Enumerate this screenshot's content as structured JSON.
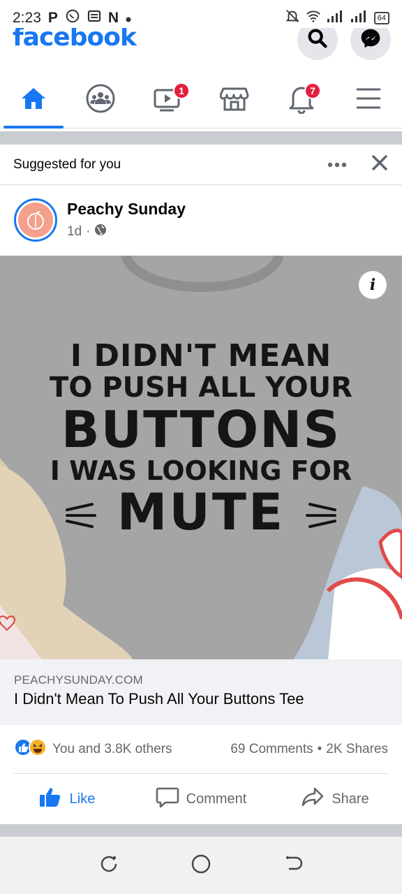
{
  "status_bar": {
    "time": "2:23",
    "left_glyphs": [
      "P",
      "N"
    ],
    "battery": "64"
  },
  "header": {
    "logo": "facebook"
  },
  "nav": {
    "items": [
      {
        "name": "home",
        "active": true
      },
      {
        "name": "groups"
      },
      {
        "name": "watch",
        "badge": "1"
      },
      {
        "name": "marketplace"
      },
      {
        "name": "notifications",
        "badge": "7"
      },
      {
        "name": "menu"
      }
    ]
  },
  "suggested": {
    "label": "Suggested for you"
  },
  "post": {
    "page_name": "Peachy Sunday",
    "time": "1d",
    "separator": "·",
    "image_text": {
      "line1": "I DIDN'T MEAN",
      "line2": "TO PUSH ALL YOUR",
      "line3": "BUTTONS",
      "line4": "I WAS LOOKING FOR",
      "line5": "MUTE"
    },
    "link": {
      "domain": "PEACHYSUNDAY.COM",
      "title": "I Didn't Mean To Push All Your Buttons Tee"
    },
    "reactions": {
      "summary": "You and 3.8K others",
      "comments": "69 Comments",
      "dot": "•",
      "shares": "2K Shares"
    },
    "actions": {
      "like": "Like",
      "comment": "Comment",
      "share": "Share"
    }
  },
  "colors": {
    "brand": "#1877f2",
    "badge": "#e41e3f",
    "shirt": "#a3a3a3"
  }
}
